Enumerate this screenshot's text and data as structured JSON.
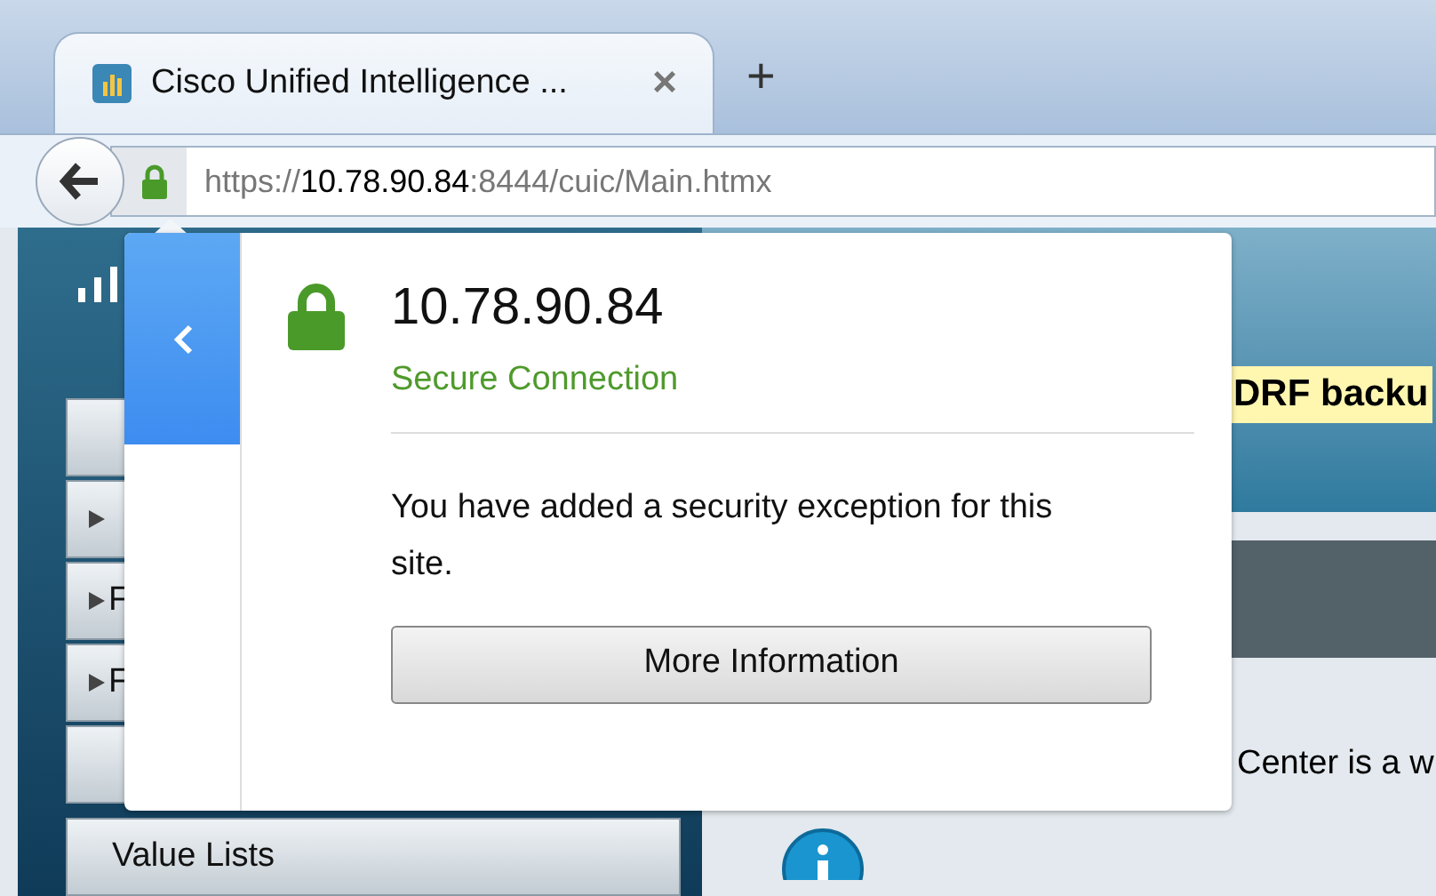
{
  "tab": {
    "title": "Cisco Unified Intelligence ...",
    "close": "×",
    "new_tab": "+"
  },
  "address_bar": {
    "scheme": "https://",
    "host": "10.78.90.84",
    "rest": ":8444/cuic/Main.htmx"
  },
  "sidebar": {
    "items": [
      {
        "kind": "plain"
      },
      {
        "kind": "folder"
      },
      {
        "label": "F",
        "kind": "folder"
      },
      {
        "label": "F",
        "kind": "folder"
      },
      {
        "kind": "plain"
      },
      {
        "label": "Value Lists",
        "kind": "plain"
      }
    ]
  },
  "page": {
    "banner": "DRF backu",
    "text": "Center is a w"
  },
  "site_popup": {
    "host": "10.78.90.84",
    "status": "Secure Connection",
    "message": "You have added a security exception for this site.",
    "button": "More Information"
  }
}
